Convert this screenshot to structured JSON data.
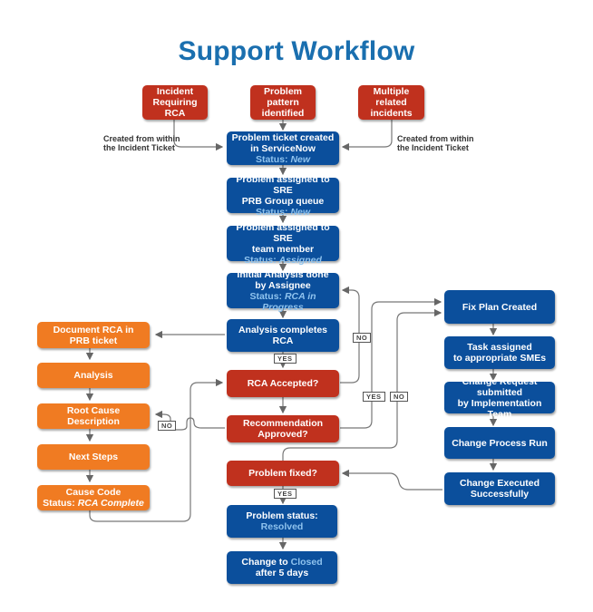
{
  "title": "Support Workflow",
  "colors": {
    "title": "#1a6faf",
    "red": "#c0311e",
    "blue": "#0b4f9c",
    "orange": "#f07b22",
    "status_highlight": "#8fc3ee"
  },
  "notes": {
    "left": [
      "Created from within",
      "the Incident Ticket"
    ],
    "right": [
      "Created from within",
      "the Incident Ticket"
    ]
  },
  "sources": [
    {
      "lines": [
        "Incident",
        "Requiring RCA"
      ]
    },
    {
      "lines": [
        "Problem pattern",
        "identified"
      ]
    },
    {
      "lines": [
        "Multiple related",
        "incidents"
      ]
    }
  ],
  "main": {
    "ticket_created": {
      "lines": [
        "Problem ticket created",
        "in ServiceNow"
      ],
      "status_label": "Status: ",
      "status_value": "New"
    },
    "assigned_queue": {
      "lines": [
        "Problem assigned to SRE",
        "PRB Group queue"
      ],
      "status_label": "Status: ",
      "status_value": "New"
    },
    "assigned_member": {
      "lines": [
        "Problem assigned to SRE",
        "team member"
      ],
      "status_label": "Status: ",
      "status_value": "Assigned"
    },
    "initial_analysis": {
      "lines": [
        "Initial Analysis done",
        "by Assignee"
      ],
      "status_label": "Status: ",
      "status_value": "RCA in Progress"
    },
    "analysis_completes": {
      "lines": [
        "Analysis completes RCA"
      ]
    },
    "rca_accepted": {
      "lines": [
        "RCA Accepted?"
      ]
    },
    "recommendation": {
      "lines": [
        "Recommendation",
        "Approved?"
      ]
    },
    "problem_fixed": {
      "lines": [
        "Problem fixed?"
      ]
    },
    "resolved": {
      "prefix": "Problem status: ",
      "value": "Resolved"
    },
    "closed": {
      "prefix": "Change to ",
      "value": "Closed",
      "line2": "after 5 days"
    }
  },
  "rca_steps": {
    "document": {
      "lines": [
        "Document RCA in",
        "PRB ticket"
      ]
    },
    "analysis": {
      "lines": [
        "Analysis"
      ]
    },
    "root_cause": {
      "lines": [
        "Root Cause Description"
      ]
    },
    "next_steps": {
      "lines": [
        "Next Steps"
      ]
    },
    "cause_code": {
      "line1": "Cause Code",
      "status_label": "Status: ",
      "status_value": "RCA Complete"
    }
  },
  "fix_steps": {
    "fix_plan": {
      "lines": [
        "Fix Plan Created"
      ]
    },
    "task_assigned": {
      "lines": [
        "Task assigned",
        "to appropriate SMEs"
      ]
    },
    "change_request": {
      "lines": [
        "Change Request submitted",
        "by Implementation Team"
      ]
    },
    "change_process": {
      "lines": [
        "Change Process Run"
      ]
    },
    "change_executed": {
      "lines": [
        "Change Executed",
        "Successfully"
      ]
    }
  },
  "labels": {
    "yes": "YES",
    "no": "NO"
  }
}
